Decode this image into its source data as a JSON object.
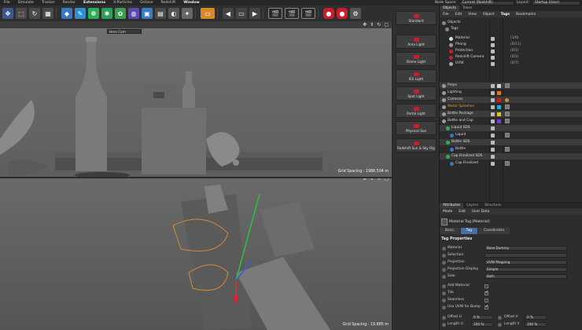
{
  "menubar": {
    "items": [
      "File",
      "Simulate",
      "Tracker",
      "Render",
      "Extensions",
      "X-Particles",
      "Octane",
      "Redshift",
      "Window"
    ],
    "active": "Extensions",
    "mode_space_label": "Node Space:",
    "mode_space_value": "Current (Redshift)",
    "layout_label": "Layout:",
    "layout_value": "Startup (User)"
  },
  "viewport_top": {
    "camera": "Hero Cam",
    "grid_spacing": "Grid Spacing : 1988.504 m"
  },
  "viewport_bottom": {
    "grid_spacing": "Grid Spacing : 19.885 m"
  },
  "lights": [
    "Standard",
    "Area Light",
    "Dome Light",
    "IES Light",
    "Spot Light",
    "Portal Light",
    "Physical Sun",
    "Redshift Sun & Sky Rig"
  ],
  "right_panel": {
    "tabs": [
      "Objects",
      "Takes"
    ],
    "menu": [
      "File",
      "Edit",
      "View",
      "Object",
      "Tags",
      "Bookmarks"
    ],
    "active_menu": "Tags"
  },
  "objects": {
    "top_root": "Objects",
    "tags_root": "Tags",
    "tags": [
      {
        "name": "Material",
        "count": "(1/6)"
      },
      {
        "name": "Phong",
        "count": "(0/11)"
      },
      {
        "name": "Protection",
        "count": "(0/1)"
      },
      {
        "name": "Redshift Camera",
        "count": "(0/1)"
      },
      {
        "name": "UVW",
        "count": "(0/7)"
      }
    ],
    "layers": [
      {
        "name": "Props",
        "color": "#d0d0d0"
      },
      {
        "name": "Lighting",
        "color": "#e07a1c"
      },
      {
        "name": "Cameras",
        "color": "#c82020"
      },
      {
        "name": "Water Splashes",
        "color": "#2aa9e0"
      },
      {
        "name": "Bottle Package",
        "color": "#d8c23a"
      },
      {
        "name": "Bottle and Cap",
        "color": "#7b3fc8"
      }
    ],
    "hierarchy": [
      "Liquid SDS",
      "Liquid",
      "Bottle SDS",
      "Bottle",
      "Cap Finalized SDS",
      "Cap Finalized"
    ]
  },
  "attributes": {
    "tabs": [
      "Attributes",
      "Layers",
      "Structure"
    ],
    "menu": [
      "Mode",
      "Edit",
      "User Data"
    ],
    "title": "Material Tag [Material]",
    "subtabs": [
      "Basic",
      "Tag",
      "Coordinates"
    ],
    "active_subtab": "Tag",
    "section": "Tag Properties",
    "rows": [
      {
        "label": "Material",
        "value": "Base Dummy"
      },
      {
        "label": "Selection",
        "value": ""
      },
      {
        "label": "Projection",
        "value": "UVW Mapping"
      },
      {
        "label": "Projection Display",
        "value": "Simple"
      },
      {
        "label": "Side",
        "value": "Both"
      }
    ],
    "checks": [
      {
        "label": "Add Material",
        "on": false
      },
      {
        "label": "Tile",
        "on": true
      },
      {
        "label": "Seamless",
        "on": false
      },
      {
        "label": "Use UVW for Bump",
        "on": true
      }
    ],
    "offset_u_label": "Offset U",
    "offset_u": "0 %",
    "offset_v_label": "Offset V",
    "offset_v": "0 %",
    "length_u_label": "Length U",
    "length_u": "100 %",
    "length_v_label": "Length V",
    "length_v": "100 %"
  },
  "colors": {
    "light_dot": "#c8202a",
    "active_tab": "#4a6fa0"
  }
}
